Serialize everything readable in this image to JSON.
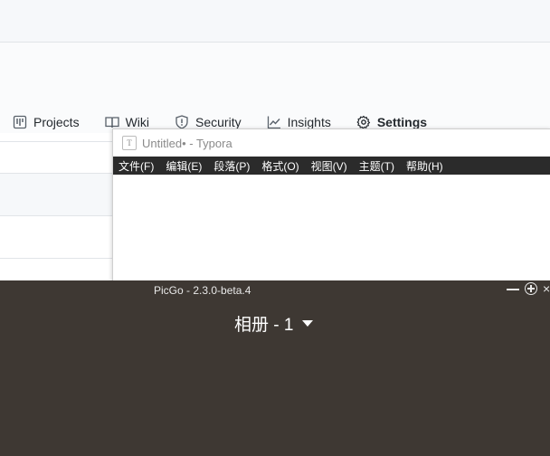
{
  "github": {
    "tabs": [
      {
        "label": "Projects",
        "icon": "project-icon"
      },
      {
        "label": "Wiki",
        "icon": "book-icon"
      },
      {
        "label": "Security",
        "icon": "shield-icon"
      },
      {
        "label": "Insights",
        "icon": "graph-icon"
      },
      {
        "label": "Settings",
        "icon": "gear-icon"
      }
    ]
  },
  "typora": {
    "title": "Untitled• - Typora",
    "menu": [
      "文件(F)",
      "编辑(E)",
      "段落(P)",
      "格式(O)",
      "视图(V)",
      "主题(T)",
      "帮助(H)"
    ]
  },
  "picgo": {
    "title": "PicGo - 2.3.0-beta.4",
    "album_label": "相册 - 1"
  },
  "colors": {
    "picgo_bg": "#3e3833",
    "typora_menu_bg": "#2b2b2b"
  }
}
